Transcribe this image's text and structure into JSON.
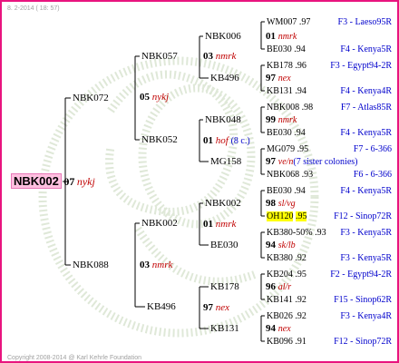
{
  "header": {
    "date_text": "8. 2-2014 ( 18: 57)"
  },
  "footer": {
    "copyright": "Copyright 2008-2014 @ Karl Kehrle Foundation"
  },
  "root": {
    "name": "NBK002",
    "year": "07",
    "breeder": "nykj"
  },
  "gen4": [
    {
      "name": "NBK072"
    },
    {
      "name": "NBK088"
    }
  ],
  "gen3": [
    {
      "name": "NBK057",
      "year": "05",
      "breeder": "nykj"
    },
    {
      "name": "NBK052"
    },
    {
      "name": "NBK002",
      "year": "03",
      "breeder": "nmrk"
    },
    {
      "name": "KB496",
      "year": "97",
      "breeder": "nex"
    }
  ],
  "gen2": [
    {
      "name": "NBK006",
      "year": "03",
      "breeder": "nmrk"
    },
    {
      "name": "KB496"
    },
    {
      "name": "NBK048",
      "year": "01",
      "breeder": "hof",
      "note": "(8 c.)"
    },
    {
      "name": "MG158"
    },
    {
      "name": "NBK002",
      "year": "01",
      "breeder": "nmrk"
    },
    {
      "name": "BE030"
    },
    {
      "name": "KB178",
      "year": "97",
      "breeder": "nex"
    },
    {
      "name": "KB131"
    }
  ],
  "gen1": [
    {
      "name": "WM007",
      "yr": ".97",
      "info": "F3 - Laeso95R"
    },
    {
      "year": "01",
      "breeder": "nmrk"
    },
    {
      "name": "BE030",
      "yr": ".94",
      "info": "F4 - Kenya5R"
    },
    {
      "name": "KB178",
      "yr": ".96",
      "info": "F3 - Egypt94-2R"
    },
    {
      "year": "97",
      "breeder": "nex"
    },
    {
      "name": "KB131",
      "yr": ".94",
      "info": "F4 - Kenya4R"
    },
    {
      "name": "NBK008",
      "yr": ".98",
      "info": "F7 - Atlas85R"
    },
    {
      "year": "99",
      "breeder": "nmrk"
    },
    {
      "name": "BE030",
      "yr": ".94",
      "info": "F4 - Kenya5R"
    },
    {
      "name": "MG079",
      "yr": ".95",
      "info": "F7 - 6-366"
    },
    {
      "year": "97",
      "breeder": "ve/n",
      "note": "(7 sister colonies)"
    },
    {
      "name": "NBK068",
      "yr": ".93",
      "info": "F6 - 6-366"
    },
    {
      "name": "BE030",
      "yr": ".94",
      "info": "F4 - Kenya5R"
    },
    {
      "year": "98",
      "breeder": "sl/vg"
    },
    {
      "name": "OH120",
      "yr": ".95",
      "info": "F12 - Sinop72R"
    },
    {
      "name": "KB380-50%",
      "yr": ".93",
      "info": "F3 - Kenya5R"
    },
    {
      "year": "94",
      "breeder": "sk/lb"
    },
    {
      "name": "KB380",
      "yr": ".92",
      "info": "F3 - Kenya5R"
    },
    {
      "name": "KB204",
      "yr": ".95",
      "info": "F2 - Egypt94-2R"
    },
    {
      "year": "96",
      "breeder": "al/r"
    },
    {
      "name": "KB141",
      "yr": ".92",
      "info": "F15 - Sinop62R"
    },
    {
      "name": "KB026",
      "yr": ".92",
      "info": "F3 - Kenya4R"
    },
    {
      "year": "94",
      "breeder": "nex"
    },
    {
      "name": "KB096",
      "yr": ".91",
      "info": "F12 - Sinop72R"
    }
  ],
  "colors": {
    "border": "#e8147e",
    "root_bg": "#ffc0e0",
    "breeder": "#c00000",
    "info": "#0000cc",
    "highlight": "#ffff00"
  }
}
